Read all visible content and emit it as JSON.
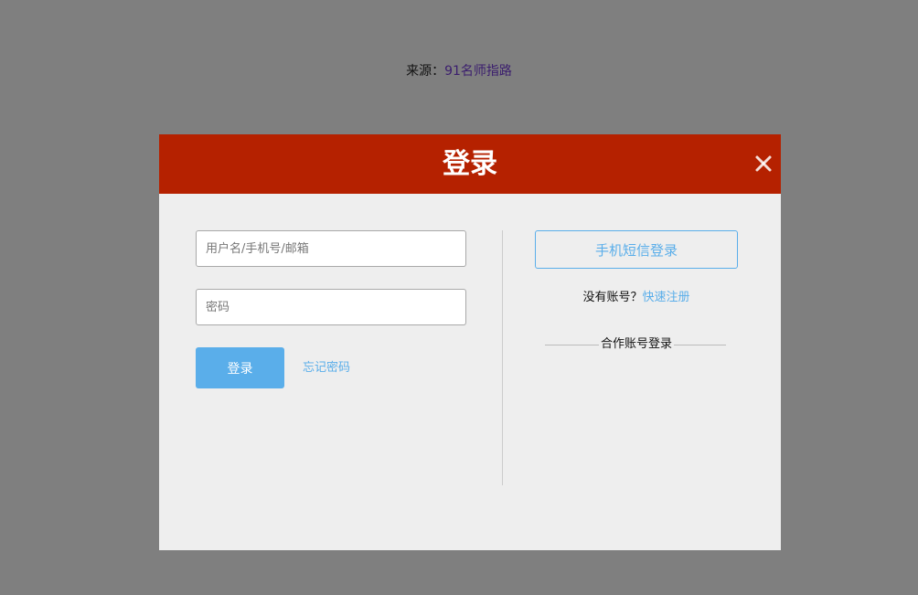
{
  "page": {
    "source_label": "来源：",
    "source_link": "91名师指路"
  },
  "modal": {
    "title": "登录",
    "close_icon": "close-icon",
    "login_form": {
      "username_placeholder": "用户名/手机号/邮箱",
      "password_placeholder": "密码",
      "login_button": "登录",
      "forgot_password": "忘记密码"
    },
    "alt_login": {
      "sms_login_button": "手机短信登录",
      "no_account_text": "没有账号？",
      "register_link": "快速注册",
      "partner_login_label": "合作账号登录"
    }
  },
  "colors": {
    "overlay": "#7f7f7f",
    "header": "#b52100",
    "accent": "#5aaeea",
    "modal_body": "#eeeeee"
  }
}
